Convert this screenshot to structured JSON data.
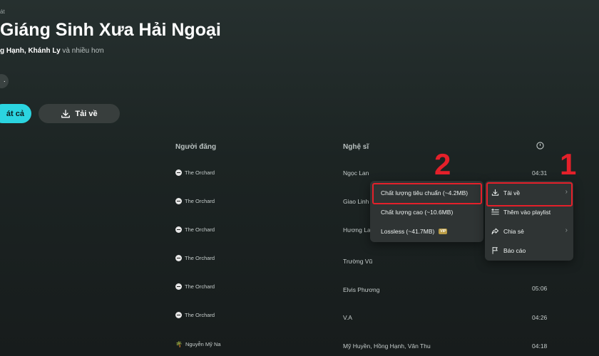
{
  "header": {
    "top_label": "át",
    "title": "Giáng Sinh Xưa Hải Ngoại",
    "artists": [
      "g Hạnh,",
      "Khánh Ly"
    ],
    "artists_more": "và nhiều hơn",
    "more_glyph": "·",
    "play_all_label": "át cả",
    "download_label": "Tải về"
  },
  "table": {
    "col_uploader": "Người đăng",
    "col_artist": "Nghệ sĩ",
    "rows": [
      {
        "uploader": "The Orchard",
        "artist": "Ngọc Lan",
        "duration": "04:31"
      },
      {
        "uploader": "The Orchard",
        "artist": "Giao Linh",
        "duration": ""
      },
      {
        "uploader": "The Orchard",
        "artist": "Hương Lan",
        "duration": ""
      },
      {
        "uploader": "The Orchard",
        "artist": "Trường Vũ",
        "duration": ""
      },
      {
        "uploader": "The Orchard",
        "artist": "Elvis Phương",
        "duration": "05:06"
      },
      {
        "uploader": "The Orchard",
        "artist": "V.A",
        "duration": "04:26"
      },
      {
        "uploader": "Nguyễn Mỹ Na",
        "artist": "Mỹ Huyền, Hồng Hạnh, Vân Thu",
        "duration": "04:18"
      }
    ]
  },
  "quality_menu": {
    "items": [
      "Chất lượng tiêu chuẩn (~4.2MB)",
      "Chất lượng cao (~10.6MB)",
      "Lossless (~41.7MB)"
    ],
    "vip_badge": "VIP"
  },
  "context_menu": {
    "items": [
      "Tải về",
      "Thêm vào playlist",
      "Chia sẻ",
      "Báo cáo"
    ]
  },
  "annotations": {
    "step1": "1",
    "step2": "2"
  },
  "colors": {
    "accent": "#2bd4e0",
    "highlight": "#e4202a",
    "menu_bg": "#2f3434"
  }
}
